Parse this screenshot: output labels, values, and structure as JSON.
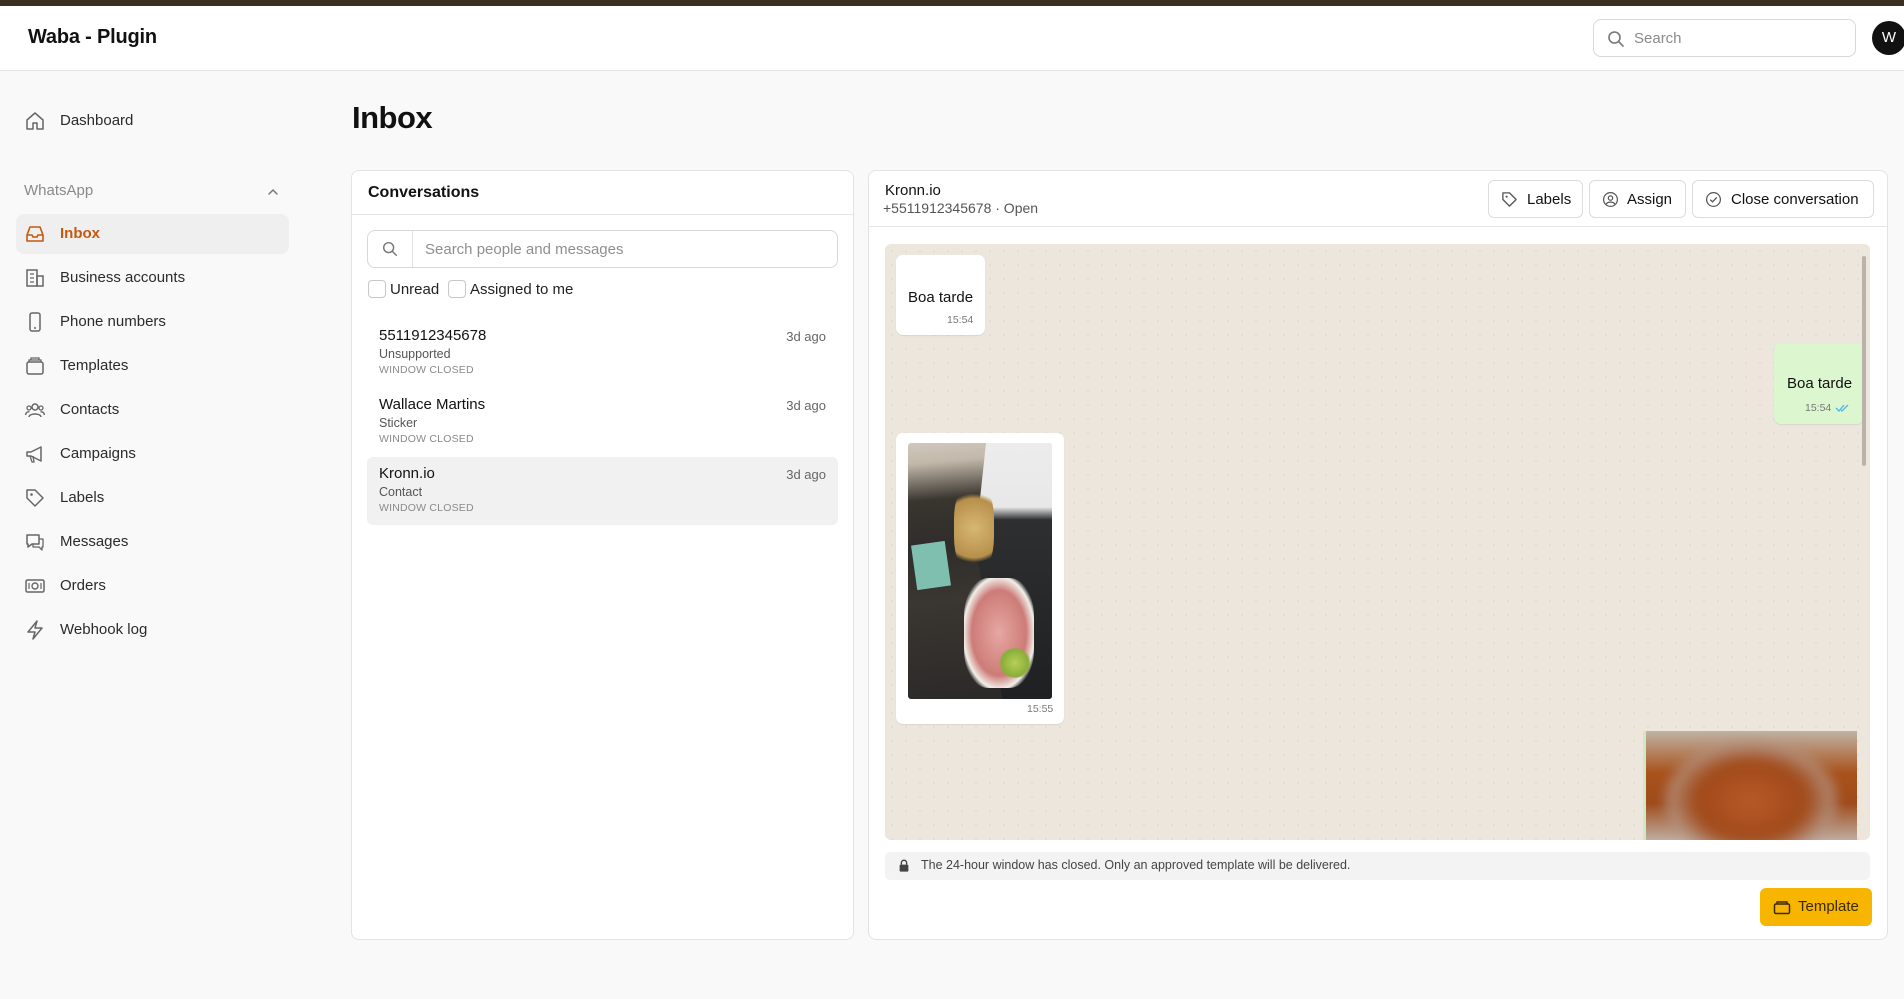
{
  "app": {
    "title": "Waba - Plugin"
  },
  "header": {
    "search_placeholder": "Search",
    "avatar_initial": "W"
  },
  "sidebar": {
    "dashboard": "Dashboard",
    "section_label": "WhatsApp",
    "items": [
      {
        "label": "Inbox",
        "icon": "inbox-icon",
        "active": true
      },
      {
        "label": "Business accounts",
        "icon": "building-icon"
      },
      {
        "label": "Phone numbers",
        "icon": "phone-icon"
      },
      {
        "label": "Templates",
        "icon": "templates-icon"
      },
      {
        "label": "Contacts",
        "icon": "contacts-icon"
      },
      {
        "label": "Campaigns",
        "icon": "megaphone-icon"
      },
      {
        "label": "Labels",
        "icon": "tag-icon"
      },
      {
        "label": "Messages",
        "icon": "messages-icon"
      },
      {
        "label": "Orders",
        "icon": "orders-icon"
      },
      {
        "label": "Webhook log",
        "icon": "bolt-icon"
      }
    ]
  },
  "page": {
    "title": "Inbox"
  },
  "conversations": {
    "title": "Conversations",
    "search_placeholder": "Search people and messages",
    "filters": {
      "unread": "Unread",
      "assigned": "Assigned to me"
    },
    "items": [
      {
        "name": "5511912345678",
        "subtitle": "Unsupported",
        "status": "WINDOW CLOSED",
        "time": "3d ago"
      },
      {
        "name": "Wallace Martins",
        "subtitle": "Sticker",
        "status": "WINDOW CLOSED",
        "time": "3d ago"
      },
      {
        "name": "Kronn.io",
        "subtitle": "Contact",
        "status": "WINDOW CLOSED",
        "time": "3d ago",
        "selected": true
      }
    ]
  },
  "chat": {
    "name": "Kronn.io",
    "meta": "+5511912345678 · Open",
    "buttons": {
      "labels": "Labels",
      "assign": "Assign",
      "close": "Close conversation"
    },
    "messages": [
      {
        "direction": "in",
        "text": "Boa tarde",
        "time": "15:54"
      },
      {
        "direction": "out",
        "text": "Boa tarde",
        "time": "15:54",
        "read": true
      },
      {
        "direction": "in",
        "type": "image",
        "time": "15:55"
      },
      {
        "direction": "out",
        "type": "image"
      }
    ],
    "notice": "The 24-hour window has closed. Only an approved template will be delivered.",
    "template_button": "Template"
  },
  "colors": {
    "accent": "#c4590f",
    "template_button": "#f7b500",
    "outgoing_bubble": "#dcf7d0",
    "chat_bg": "#ede6dd",
    "read_check": "#4fb6ec"
  }
}
